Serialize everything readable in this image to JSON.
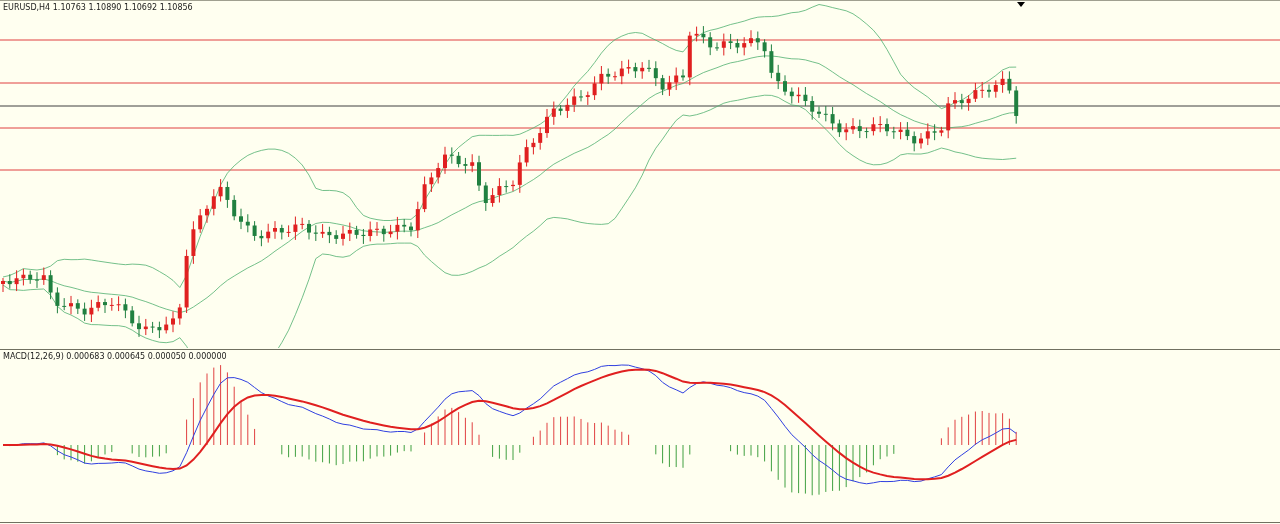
{
  "price_chart": {
    "label": "EURUSD,H4  1.10763 1.10890 1.10692 1.10856"
  },
  "macd_panel": {
    "label": "MACD(12,26,9) 0.000683 0.000645 0.000050 0.000000"
  }
}
